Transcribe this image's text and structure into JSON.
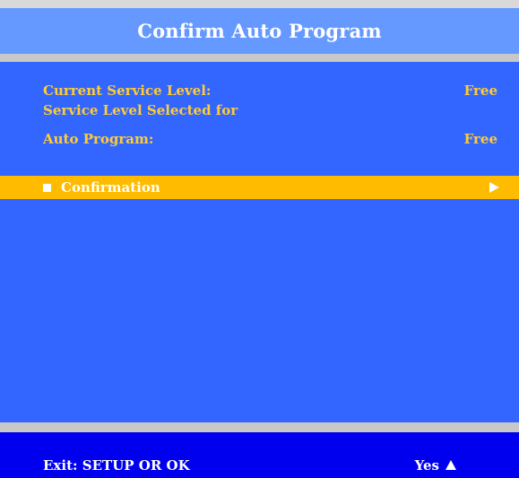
{
  "screen": {
    "title": "Confirm Auto Program"
  },
  "service": {
    "current_label": "Current Service Level:",
    "current_value": "Free",
    "selected_label_line1": "Service Level Selected for",
    "selected_label_line2": "Auto Program:",
    "selected_value": "Free"
  },
  "menu": {
    "confirmation_label": "Confirmation",
    "confirmation_bullet_icon": "square-bullet-icon",
    "confirmation_arrow_icon": "play-right-icon"
  },
  "footer": {
    "exit_label": "Exit:  SETUP OR OK",
    "yes_label": "Yes",
    "yes_icon": "up-triangle-icon"
  },
  "colors": {
    "title_bar": "#6699ff",
    "panel": "#3366ff",
    "highlight": "#ffbb00",
    "info_text": "#ffcc33",
    "footer": "#0000ee",
    "separator": "#c8c8c8"
  }
}
